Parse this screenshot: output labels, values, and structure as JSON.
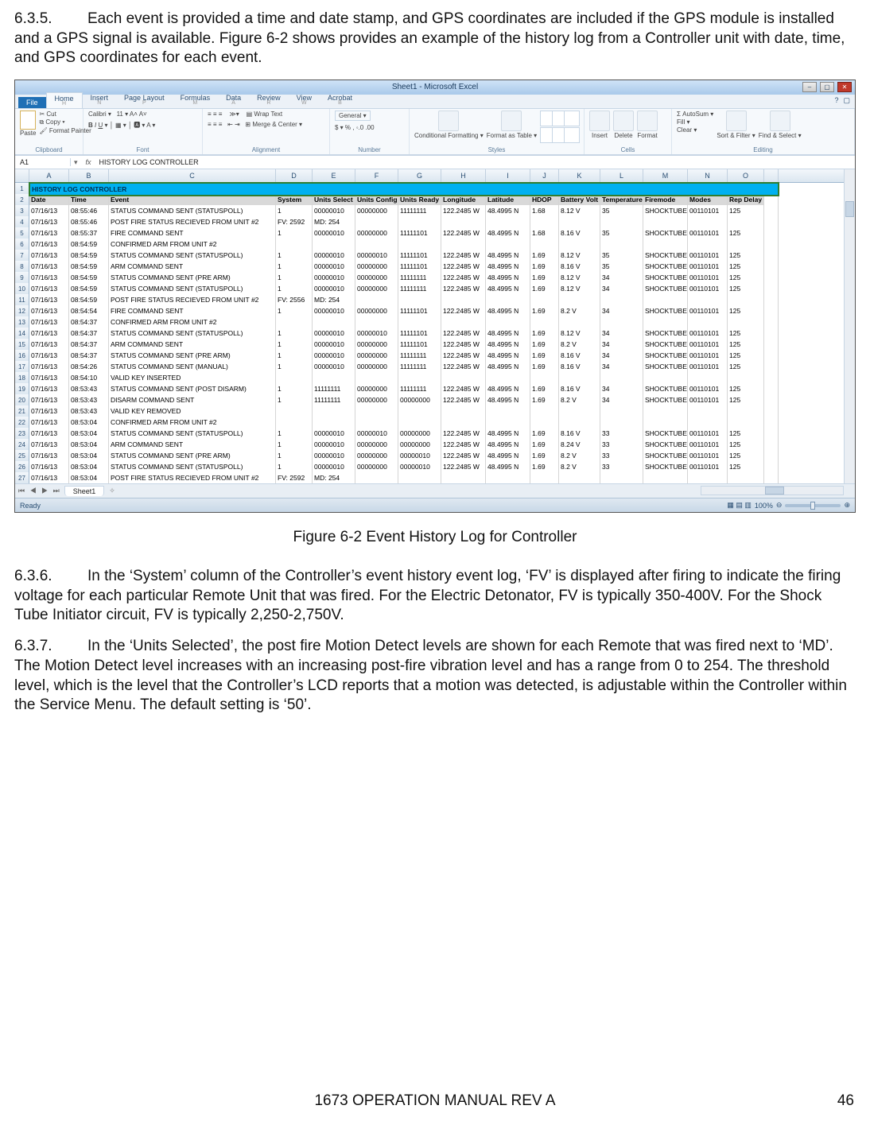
{
  "text": {
    "p635_num": "6.3.5.",
    "p635": "Each event is provided a time and date stamp, and GPS coordinates are included if the GPS module is installed and a GPS signal is available. Figure 6-2 shows provides an example of the history log from a Controller unit with date, time, and GPS coordinates for each event.",
    "caption": "Figure 6-2 Event History Log for Controller",
    "p636_num": "6.3.6.",
    "p636": "In the ‘System’ column of the Controller’s event history event log, ‘FV’ is displayed after firing to indicate the firing voltage for each particular Remote Unit that was fired. For the Electric Detonator, FV is typically 350-400V. For the Shock Tube Initiator circuit, FV is typically 2,250-2,750V.",
    "p637_num": "6.3.7.",
    "p637": "In the ‘Units Selected’, the post fire Motion Detect levels are shown for each Remote that was fired next to ‘MD’. The Motion Detect level increases with an increasing post-fire vibration level and has a range from 0 to 254. The threshold level, which is the level that the Controller’s LCD reports that a motion was detected, is adjustable within the Controller within the Service Menu. The default setting is ‘50’.",
    "footer": "1673 OPERATION MANUAL REV A",
    "pagenum": "46"
  },
  "excel": {
    "title": "Sheet1 - Microsoft Excel",
    "tabs": {
      "file": "File",
      "list": [
        "Home",
        "Insert",
        "Page Layout",
        "Formulas",
        "Data",
        "Review",
        "View",
        "Acrobat"
      ],
      "keys": [
        "H",
        "N",
        "P",
        "M",
        "A",
        "R",
        "W",
        "B"
      ]
    },
    "groups": {
      "clipboard": "Clipboard",
      "font": "Font",
      "alignment": "Alignment",
      "number": "Number",
      "styles": "Styles",
      "cells": "Cells",
      "editing": "Editing"
    },
    "clipboard_items": {
      "cut": "Cut",
      "copy": "Copy ▾",
      "fp": "Format Painter",
      "paste": "Paste"
    },
    "font_items": {
      "name": "Calibri",
      "size": "11"
    },
    "alignment_items": {
      "wrap": "Wrap Text",
      "merge": "Merge & Center ▾"
    },
    "number_items": {
      "fmt": "$ ▾  % ,  ◦.0 .00"
    },
    "styles_items": {
      "cf": "Conditional Formatting ▾",
      "ft": "Format as Table ▾"
    },
    "cells_items": {
      "ins": "Insert",
      "del": "Delete",
      "fmt": "Format"
    },
    "editing_items": {
      "sum": "Σ AutoSum ▾",
      "fill": "Fill ▾",
      "clear": "Clear ▾",
      "sort": "Sort & Filter ▾",
      "find": "Find & Select ▾"
    },
    "namebox": "A1",
    "formula_val": "HISTORY LOG CONTROLLER",
    "col_letters": [
      "",
      "A",
      "B",
      "C",
      "D",
      "E",
      "F",
      "G",
      "H",
      "I",
      "J",
      "K",
      "L",
      "M",
      "N",
      "O",
      ""
    ],
    "title_cell": "HISTORY LOG CONTROLLER",
    "headers": [
      "Date",
      "Time",
      "Event",
      "System",
      "Units Select",
      "Units Config",
      "Units Ready",
      "Longitude",
      "Latitude",
      "HDOP",
      "Battery Volt",
      "Temperature",
      "Firemode",
      "Modes",
      "Rep Delay"
    ],
    "rows": [
      {
        "n": 3,
        "d": [
          "07/16/13",
          "08:55:46",
          "STATUS COMMAND SENT (STATUSPOLL)",
          "1",
          "00000010",
          "00000000",
          "11111111",
          "122.2485 W",
          "48.4995 N",
          "1.68",
          "8.12 V",
          "35",
          "SHOCKTUBE",
          "00110101",
          "125"
        ]
      },
      {
        "n": 4,
        "d": [
          "07/16/13",
          "08:55:46",
          "POST FIRE STATUS RECIEVED FROM UNIT #2",
          "FV: 2592",
          "MD: 254",
          "",
          "",
          "",
          "",
          "",
          "",
          "",
          "",
          "",
          ""
        ]
      },
      {
        "n": 5,
        "d": [
          "07/16/13",
          "08:55:37",
          "FIRE COMMAND SENT",
          "1",
          "00000010",
          "00000000",
          "11111101",
          "122.2485 W",
          "48.4995 N",
          "1.68",
          "8.16 V",
          "35",
          "SHOCKTUBE",
          "00110101",
          "125"
        ]
      },
      {
        "n": 6,
        "d": [
          "07/16/13",
          "08:54:59",
          "CONFIRMED ARM FROM UNIT #2",
          "",
          "",
          "",
          "",
          "",
          "",
          "",
          "",
          "",
          "",
          "",
          ""
        ]
      },
      {
        "n": 7,
        "d": [
          "07/16/13",
          "08:54:59",
          "STATUS COMMAND SENT (STATUSPOLL)",
          "1",
          "00000010",
          "00000010",
          "11111101",
          "122.2485 W",
          "48.4995 N",
          "1.69",
          "8.12 V",
          "35",
          "SHOCKTUBE",
          "00110101",
          "125"
        ]
      },
      {
        "n": 8,
        "d": [
          "07/16/13",
          "08:54:59",
          "ARM COMMAND SENT",
          "1",
          "00000010",
          "00000000",
          "11111101",
          "122.2485 W",
          "48.4995 N",
          "1.69",
          "8.16 V",
          "35",
          "SHOCKTUBE",
          "00110101",
          "125"
        ]
      },
      {
        "n": 9,
        "d": [
          "07/16/13",
          "08:54:59",
          "STATUS COMMAND SENT (PRE ARM)",
          "1",
          "00000010",
          "00000000",
          "11111111",
          "122.2485 W",
          "48.4995 N",
          "1.69",
          "8.12 V",
          "34",
          "SHOCKTUBE",
          "00110101",
          "125"
        ]
      },
      {
        "n": 10,
        "d": [
          "07/16/13",
          "08:54:59",
          "STATUS COMMAND SENT (STATUSPOLL)",
          "1",
          "00000010",
          "00000000",
          "11111111",
          "122.2485 W",
          "48.4995 N",
          "1.69",
          "8.12 V",
          "34",
          "SHOCKTUBE",
          "00110101",
          "125"
        ]
      },
      {
        "n": 11,
        "d": [
          "07/16/13",
          "08:54:59",
          "POST FIRE STATUS RECIEVED FROM UNIT #2",
          "FV: 2556",
          "MD: 254",
          "",
          "",
          "",
          "",
          "",
          "",
          "",
          "",
          "",
          ""
        ]
      },
      {
        "n": 12,
        "d": [
          "07/16/13",
          "08:54:54",
          "FIRE COMMAND SENT",
          "1",
          "00000010",
          "00000000",
          "11111101",
          "122.2485 W",
          "48.4995 N",
          "1.69",
          "8.2 V",
          "34",
          "SHOCKTUBE",
          "00110101",
          "125"
        ]
      },
      {
        "n": 13,
        "d": [
          "07/16/13",
          "08:54:37",
          "CONFIRMED ARM FROM UNIT #2",
          "",
          "",
          "",
          "",
          "",
          "",
          "",
          "",
          "",
          "",
          "",
          ""
        ]
      },
      {
        "n": 14,
        "d": [
          "07/16/13",
          "08:54:37",
          "STATUS COMMAND SENT (STATUSPOLL)",
          "1",
          "00000010",
          "00000010",
          "11111101",
          "122.2485 W",
          "48.4995 N",
          "1.69",
          "8.12 V",
          "34",
          "SHOCKTUBE",
          "00110101",
          "125"
        ]
      },
      {
        "n": 15,
        "d": [
          "07/16/13",
          "08:54:37",
          "ARM COMMAND SENT",
          "1",
          "00000010",
          "00000000",
          "11111101",
          "122.2485 W",
          "48.4995 N",
          "1.69",
          "8.2 V",
          "34",
          "SHOCKTUBE",
          "00110101",
          "125"
        ]
      },
      {
        "n": 16,
        "d": [
          "07/16/13",
          "08:54:37",
          "STATUS COMMAND SENT (PRE ARM)",
          "1",
          "00000010",
          "00000000",
          "11111111",
          "122.2485 W",
          "48.4995 N",
          "1.69",
          "8.16 V",
          "34",
          "SHOCKTUBE",
          "00110101",
          "125"
        ]
      },
      {
        "n": 17,
        "d": [
          "07/16/13",
          "08:54:26",
          "STATUS COMMAND SENT (MANUAL)",
          "1",
          "00000010",
          "00000000",
          "11111111",
          "122.2485 W",
          "48.4995 N",
          "1.69",
          "8.16 V",
          "34",
          "SHOCKTUBE",
          "00110101",
          "125"
        ]
      },
      {
        "n": 18,
        "d": [
          "07/16/13",
          "08:54:10",
          "VALID KEY INSERTED",
          "",
          "",
          "",
          "",
          "",
          "",
          "",
          "",
          "",
          "",
          "",
          ""
        ]
      },
      {
        "n": 19,
        "d": [
          "07/16/13",
          "08:53:43",
          "STATUS COMMAND SENT (POST DISARM)",
          "1",
          "11111111",
          "00000000",
          "11111111",
          "122.2485 W",
          "48.4995 N",
          "1.69",
          "8.16 V",
          "34",
          "SHOCKTUBE",
          "00110101",
          "125"
        ]
      },
      {
        "n": 20,
        "d": [
          "07/16/13",
          "08:53:43",
          "DISARM COMMAND SENT",
          "1",
          "11111111",
          "00000000",
          "00000000",
          "122.2485 W",
          "48.4995 N",
          "1.69",
          "8.2 V",
          "34",
          "SHOCKTUBE",
          "00110101",
          "125"
        ]
      },
      {
        "n": 21,
        "d": [
          "07/16/13",
          "08:53:43",
          "VALID KEY REMOVED",
          "",
          "",
          "",
          "",
          "",
          "",
          "",
          "",
          "",
          "",
          "",
          ""
        ]
      },
      {
        "n": 22,
        "d": [
          "07/16/13",
          "08:53:04",
          "CONFIRMED ARM FROM UNIT #2",
          "",
          "",
          "",
          "",
          "",
          "",
          "",
          "",
          "",
          "",
          "",
          ""
        ]
      },
      {
        "n": 23,
        "d": [
          "07/16/13",
          "08:53:04",
          "STATUS COMMAND SENT (STATUSPOLL)",
          "1",
          "00000010",
          "00000010",
          "00000000",
          "122.2485 W",
          "48.4995 N",
          "1.69",
          "8.16 V",
          "33",
          "SHOCKTUBE",
          "00110101",
          "125"
        ]
      },
      {
        "n": 24,
        "d": [
          "07/16/13",
          "08:53:04",
          "ARM COMMAND SENT",
          "1",
          "00000010",
          "00000000",
          "00000000",
          "122.2485 W",
          "48.4995 N",
          "1.69",
          "8.24 V",
          "33",
          "SHOCKTUBE",
          "00110101",
          "125"
        ]
      },
      {
        "n": 25,
        "d": [
          "07/16/13",
          "08:53:04",
          "STATUS COMMAND SENT (PRE ARM)",
          "1",
          "00000010",
          "00000000",
          "00000010",
          "122.2485 W",
          "48.4995 N",
          "1.69",
          "8.2 V",
          "33",
          "SHOCKTUBE",
          "00110101",
          "125"
        ]
      },
      {
        "n": 26,
        "d": [
          "07/16/13",
          "08:53:04",
          "STATUS COMMAND SENT (STATUSPOLL)",
          "1",
          "00000010",
          "00000000",
          "00000010",
          "122.2485 W",
          "48.4995 N",
          "1.69",
          "8.2 V",
          "33",
          "SHOCKTUBE",
          "00110101",
          "125"
        ]
      },
      {
        "n": 27,
        "d": [
          "07/16/13",
          "08:53:04",
          "POST FIRE STATUS RECIEVED FROM UNIT #2",
          "FV: 2592",
          "MD: 254",
          "",
          "",
          "",
          "",
          "",
          "",
          "",
          "",
          "",
          ""
        ]
      }
    ],
    "sheettab": "Sheet1",
    "status_ready": "Ready",
    "zoom": "100%"
  }
}
